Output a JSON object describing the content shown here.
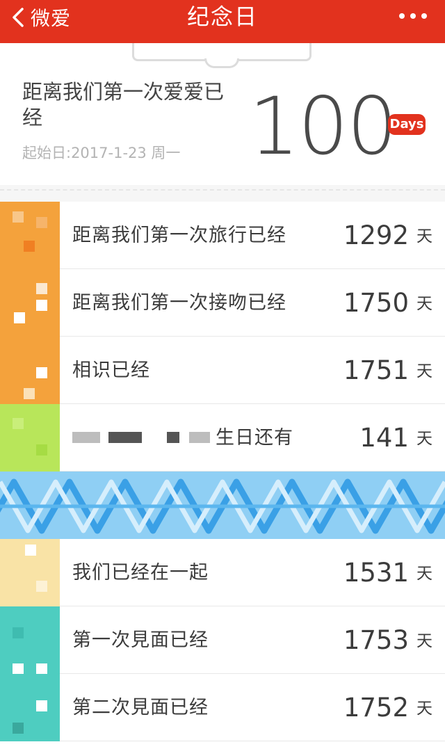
{
  "nav": {
    "back_label": "微爱",
    "title": "纪念日",
    "more_icon": "more-dots-icon"
  },
  "hero": {
    "title": "距离我们第一次爱爱已经",
    "start_date": "起始日:2017-1-23 周一",
    "count": "100",
    "badge": "Days"
  },
  "colors": {
    "brand_red": "#e2321e",
    "banner_blue": "#8fcff4"
  },
  "rows": [
    {
      "label": "距离我们第一次旅行已经",
      "value": "1292",
      "unit": "天",
      "icon_color": "#f4a23c"
    },
    {
      "label": "距离我们第一次接吻已经",
      "value": "1750",
      "unit": "天",
      "icon_color": "#f4a23c"
    },
    {
      "label": "相识已经",
      "value": "1751",
      "unit": "天",
      "icon_color": "#f4a23c"
    },
    {
      "label": "生日还有",
      "value": "141",
      "unit": "天",
      "icon_color": "#b8e65a"
    },
    {
      "label": "我们已经在一起",
      "value": "1531",
      "unit": "天",
      "icon_color": "#f9e3a6"
    },
    {
      "label": "第一次見面已经",
      "value": "1753",
      "unit": "天",
      "icon_color": "#4ecdc0"
    },
    {
      "label": "第二次見面已经",
      "value": "1752",
      "unit": "天",
      "icon_color": "#4ecdc0"
    }
  ]
}
